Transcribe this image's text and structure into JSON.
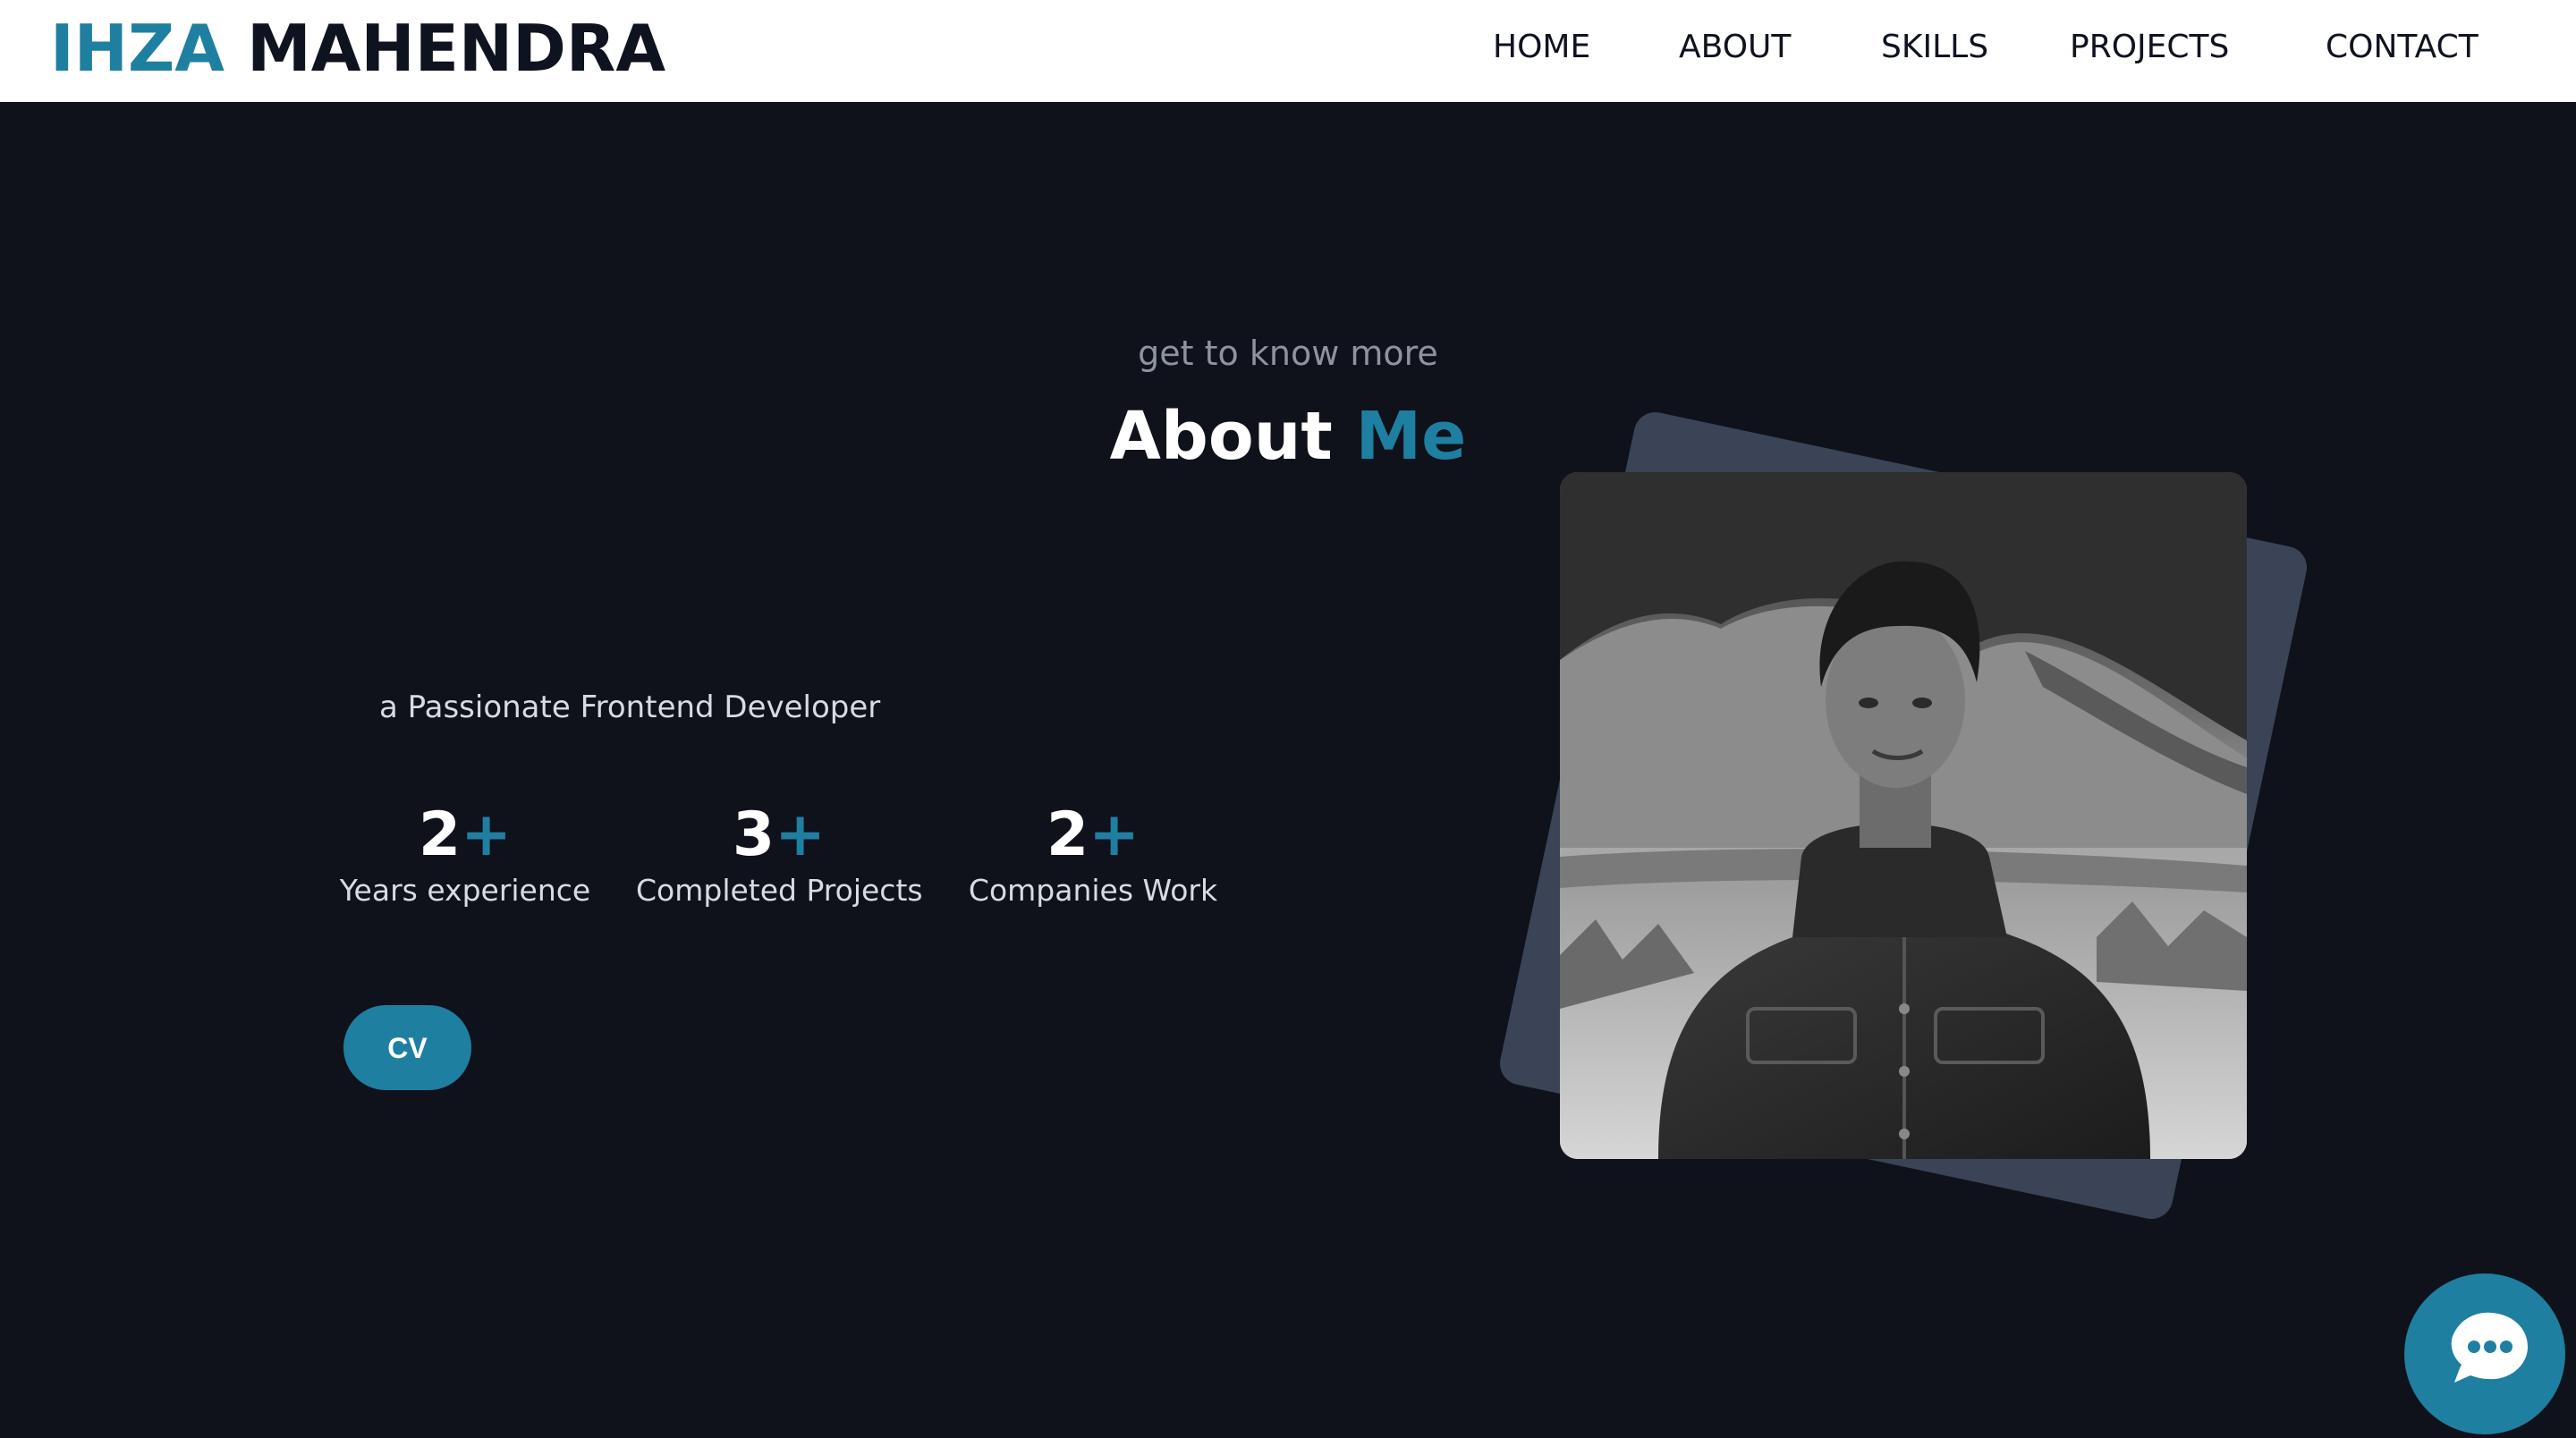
{
  "brand": {
    "first_name": "IHZA",
    "last_name": "MAHENDRA",
    "accent_color": "#1f7fa1"
  },
  "nav": {
    "items": [
      {
        "label": "HOME"
      },
      {
        "label": "ABOUT"
      },
      {
        "label": "SKILLS"
      },
      {
        "label": "PROJECTS"
      },
      {
        "label": "CONTACT"
      }
    ]
  },
  "about": {
    "subtitle": "get to know more",
    "heading_main": "About",
    "heading_accent": "Me",
    "tagline": "a Passionate Frontend Developer",
    "stats": [
      {
        "number": "2",
        "suffix": "+",
        "label": "Years experience"
      },
      {
        "number": "3",
        "suffix": "+",
        "label": "Completed Projects"
      },
      {
        "number": "2",
        "suffix": "+",
        "label": "Companies Work"
      }
    ],
    "cv_label": "CV"
  },
  "photo": {
    "icon": "profile-photo",
    "style": "grayscale"
  },
  "chat": {
    "icon": "chat-bubble-icon"
  }
}
